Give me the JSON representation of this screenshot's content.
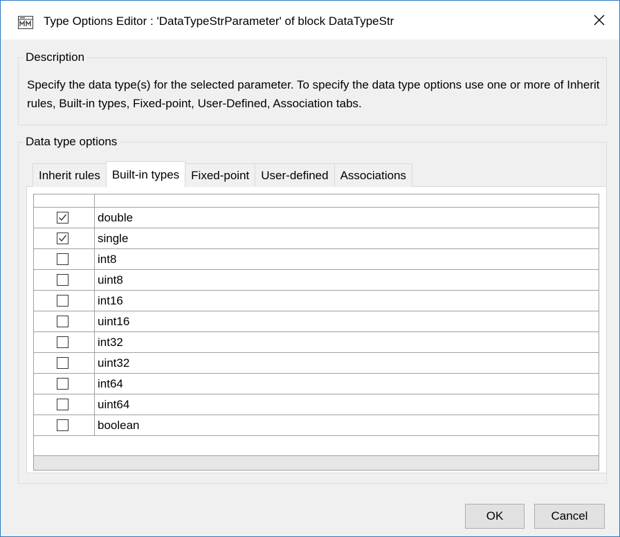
{
  "window": {
    "title": "Type Options Editor : 'DataTypeStrParameter' of block DataTypeStr",
    "app_icon": "simulink-model-icon",
    "close_icon": "close-icon"
  },
  "description": {
    "legend": "Description",
    "text": "Specify the data type(s) for the selected parameter. To specify the data type options use one or more of Inherit rules, Built-in types, Fixed-point, User-Defined, Association tabs."
  },
  "data_type_options": {
    "legend": "Data type options",
    "tabs": [
      {
        "label": "Inherit rules",
        "active": false
      },
      {
        "label": "Built-in types",
        "active": true
      },
      {
        "label": "Fixed-point",
        "active": false
      },
      {
        "label": "User-defined",
        "active": false
      },
      {
        "label": "Associations",
        "active": false
      }
    ],
    "types": [
      {
        "name": "double",
        "checked": true
      },
      {
        "name": "single",
        "checked": true
      },
      {
        "name": "int8",
        "checked": false
      },
      {
        "name": "uint8",
        "checked": false
      },
      {
        "name": "int16",
        "checked": false
      },
      {
        "name": "uint16",
        "checked": false
      },
      {
        "name": "int32",
        "checked": false
      },
      {
        "name": "uint32",
        "checked": false
      },
      {
        "name": "int64",
        "checked": false
      },
      {
        "name": "uint64",
        "checked": false
      },
      {
        "name": "boolean",
        "checked": false
      }
    ]
  },
  "buttons": {
    "ok": "OK",
    "cancel": "Cancel"
  },
  "colors": {
    "window_border": "#2b78c5",
    "dialog_bg": "#f0f0f0",
    "button_bg": "#e1e1e1",
    "grid_line": "#a0a0a0"
  }
}
